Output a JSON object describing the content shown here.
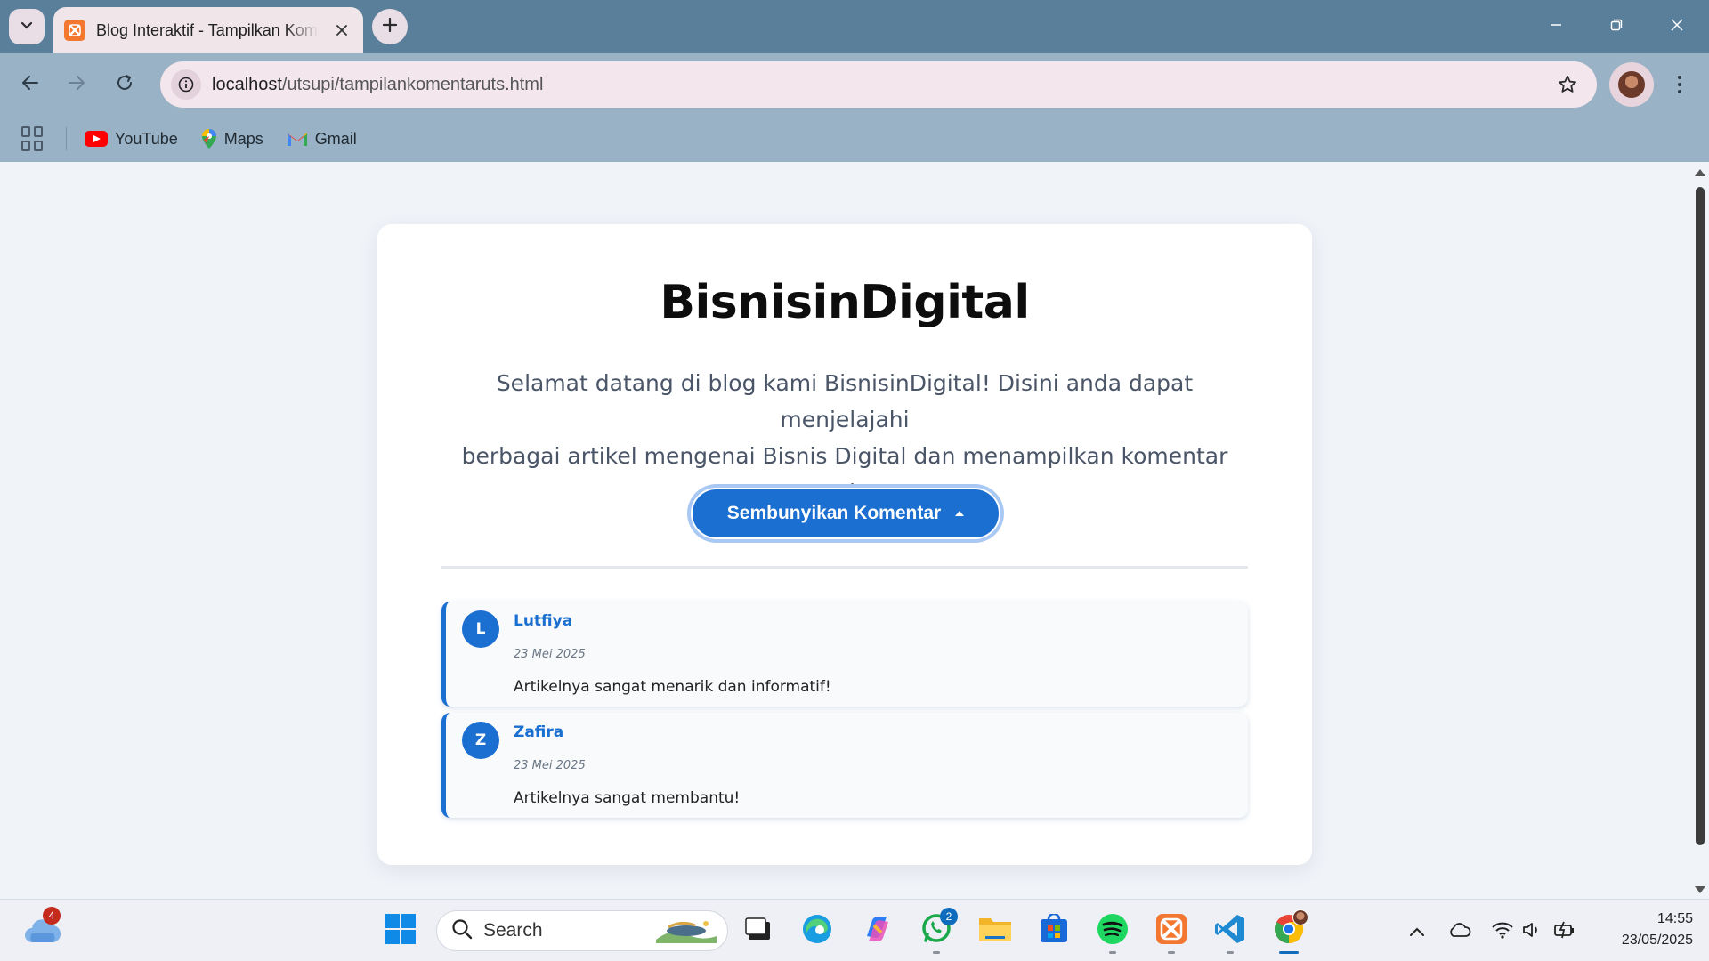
{
  "browser": {
    "tab_title": "Blog Interaktif - Tampilkan Komentar",
    "url_host": "localhost",
    "url_path": "/utsupi/tampilankomentaruts.html",
    "bookmarks": [
      {
        "label": "YouTube",
        "icon": "youtube-icon"
      },
      {
        "label": "Maps",
        "icon": "maps-icon"
      },
      {
        "label": "Gmail",
        "icon": "gmail-icon"
      }
    ]
  },
  "page": {
    "title": "BisnisinDigital",
    "intro_line1": "Selamat datang di blog kami BisnisinDigital! Disini anda dapat menjelajahi",
    "intro_line2": "berbagai artikel mengenai Bisnis Digital dan menampilkan komentar anda.",
    "toggle_label": "Sembunyikan Komentar",
    "accent_color": "#1a6fd1",
    "comments": [
      {
        "initial": "L",
        "name": "Lutfiya",
        "date": "23 Mei 2025",
        "text": "Artikelnya sangat menarik dan informatif!"
      },
      {
        "initial": "Z",
        "name": "Zafira",
        "date": "23 Mei 2025",
        "text": "Artikelnya sangat membantu!"
      }
    ]
  },
  "taskbar": {
    "weather_badge": "4",
    "search_label": "Search",
    "whatsapp_badge": "2",
    "time": "14:55",
    "date": "23/05/2025"
  }
}
